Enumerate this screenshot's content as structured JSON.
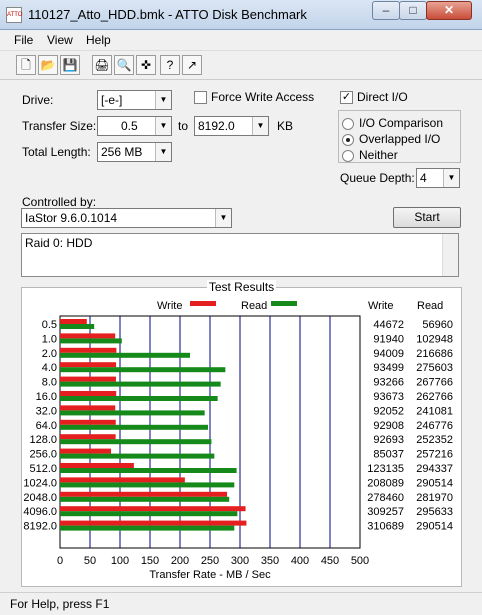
{
  "window": {
    "title": "110127_Atto_HDD.bmk - ATTO Disk Benchmark",
    "icon_text": "ATTO"
  },
  "titlebar_buttons": {
    "min": "–",
    "max": "□",
    "close": "✕"
  },
  "menu": {
    "items": [
      "File",
      "View",
      "Help"
    ]
  },
  "toolbar": {
    "icons": [
      "new-icon",
      "open-icon",
      "save-icon",
      "print-icon",
      "print-preview-icon",
      "move-icon",
      "help-icon",
      "context-help-icon"
    ],
    "glyphs": [
      "🗋",
      "📂",
      "💾",
      "🖨",
      "🔍",
      "✜",
      "?",
      "↗"
    ]
  },
  "form": {
    "drive_label": "Drive:",
    "drive_value": "[-e-]",
    "force_write_label": "Force Write Access",
    "direct_io_label": "Direct I/O",
    "direct_io_checked": "✓",
    "transfer_size_label": "Transfer Size:",
    "transfer_from": "0.5",
    "to_label": "to",
    "transfer_to": "8192.0",
    "kb_label": "KB",
    "total_length_label": "Total Length:",
    "total_length_value": "256 MB",
    "io_comparison_label": "I/O Comparison",
    "overlapped_io_label": "Overlapped I/O",
    "neither_label": "Neither",
    "queue_depth_label": "Queue Depth:",
    "queue_depth_value": "4",
    "controlled_by_label": "Controlled by:",
    "controlled_by_value": "IaStor 9.6.0.1014",
    "start_label": "Start",
    "description": "Raid 0: HDD"
  },
  "results": {
    "title": "Test Results",
    "legend_write": "Write",
    "legend_read": "Read",
    "col_write": "Write",
    "col_read": "Read"
  },
  "chart_data": {
    "type": "bar",
    "orientation": "horizontal",
    "categories": [
      "0.5",
      "1.0",
      "2.0",
      "4.0",
      "8.0",
      "16.0",
      "32.0",
      "64.0",
      "128.0",
      "256.0",
      "512.0",
      "1024.0",
      "2048.0",
      "4096.0",
      "8192.0"
    ],
    "series": [
      {
        "name": "Write",
        "color": "#e51f1f",
        "values": [
          44672,
          91940,
          94009,
          93499,
          93266,
          93673,
          92052,
          92908,
          92693,
          85037,
          123135,
          208089,
          278460,
          309257,
          310689
        ]
      },
      {
        "name": "Read",
        "color": "#158a1a",
        "values": [
          56960,
          102948,
          216686,
          275603,
          267766,
          262766,
          241081,
          246776,
          252352,
          257216,
          294337,
          290514,
          281970,
          295633,
          290514
        ]
      }
    ],
    "xlabel": "Transfer Rate - MB / Sec",
    "xlim": [
      0,
      500
    ],
    "xticks": [
      "0",
      "50",
      "100",
      "150",
      "200",
      "250",
      "300",
      "350",
      "400",
      "450",
      "500"
    ],
    "grid": true,
    "legend": "top"
  },
  "status": {
    "text": "For Help, press F1"
  }
}
